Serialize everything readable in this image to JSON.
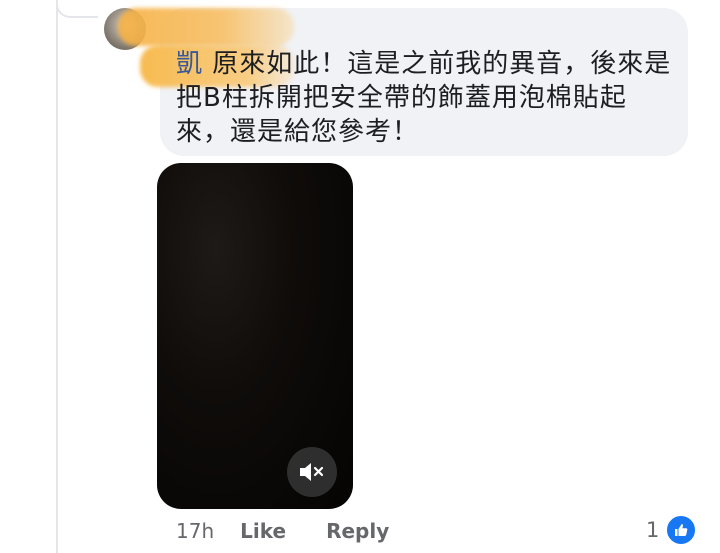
{
  "comment": {
    "author_tail": "凱",
    "text": "原來如此！這是之前我的異音，後來是把B柱拆開把安全帶的飾蓋用泡棉貼起來，還是給您參考！",
    "timestamp": "17h",
    "like_label": "Like",
    "reply_label": "Reply",
    "reaction_count": "1"
  },
  "video": {
    "muted": true,
    "mute_icon": "speaker-muted-icon"
  },
  "colors": {
    "bubble": "#f0f2f5",
    "meta_text": "#65676b",
    "like_blue": "#1877f2",
    "redaction_orange": "#f6b042"
  }
}
